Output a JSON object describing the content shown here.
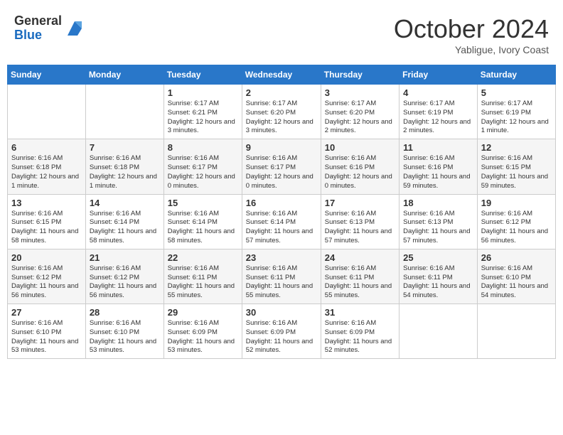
{
  "header": {
    "logo_general": "General",
    "logo_blue": "Blue",
    "month": "October 2024",
    "location": "Yabligue, Ivory Coast"
  },
  "weekdays": [
    "Sunday",
    "Monday",
    "Tuesday",
    "Wednesday",
    "Thursday",
    "Friday",
    "Saturday"
  ],
  "weeks": [
    [
      {
        "day": "",
        "info": ""
      },
      {
        "day": "",
        "info": ""
      },
      {
        "day": "1",
        "info": "Sunrise: 6:17 AM\nSunset: 6:21 PM\nDaylight: 12 hours and 3 minutes."
      },
      {
        "day": "2",
        "info": "Sunrise: 6:17 AM\nSunset: 6:20 PM\nDaylight: 12 hours and 3 minutes."
      },
      {
        "day": "3",
        "info": "Sunrise: 6:17 AM\nSunset: 6:20 PM\nDaylight: 12 hours and 2 minutes."
      },
      {
        "day": "4",
        "info": "Sunrise: 6:17 AM\nSunset: 6:19 PM\nDaylight: 12 hours and 2 minutes."
      },
      {
        "day": "5",
        "info": "Sunrise: 6:17 AM\nSunset: 6:19 PM\nDaylight: 12 hours and 1 minute."
      }
    ],
    [
      {
        "day": "6",
        "info": "Sunrise: 6:16 AM\nSunset: 6:18 PM\nDaylight: 12 hours and 1 minute."
      },
      {
        "day": "7",
        "info": "Sunrise: 6:16 AM\nSunset: 6:18 PM\nDaylight: 12 hours and 1 minute."
      },
      {
        "day": "8",
        "info": "Sunrise: 6:16 AM\nSunset: 6:17 PM\nDaylight: 12 hours and 0 minutes."
      },
      {
        "day": "9",
        "info": "Sunrise: 6:16 AM\nSunset: 6:17 PM\nDaylight: 12 hours and 0 minutes."
      },
      {
        "day": "10",
        "info": "Sunrise: 6:16 AM\nSunset: 6:16 PM\nDaylight: 12 hours and 0 minutes."
      },
      {
        "day": "11",
        "info": "Sunrise: 6:16 AM\nSunset: 6:16 PM\nDaylight: 11 hours and 59 minutes."
      },
      {
        "day": "12",
        "info": "Sunrise: 6:16 AM\nSunset: 6:15 PM\nDaylight: 11 hours and 59 minutes."
      }
    ],
    [
      {
        "day": "13",
        "info": "Sunrise: 6:16 AM\nSunset: 6:15 PM\nDaylight: 11 hours and 58 minutes."
      },
      {
        "day": "14",
        "info": "Sunrise: 6:16 AM\nSunset: 6:14 PM\nDaylight: 11 hours and 58 minutes."
      },
      {
        "day": "15",
        "info": "Sunrise: 6:16 AM\nSunset: 6:14 PM\nDaylight: 11 hours and 58 minutes."
      },
      {
        "day": "16",
        "info": "Sunrise: 6:16 AM\nSunset: 6:14 PM\nDaylight: 11 hours and 57 minutes."
      },
      {
        "day": "17",
        "info": "Sunrise: 6:16 AM\nSunset: 6:13 PM\nDaylight: 11 hours and 57 minutes."
      },
      {
        "day": "18",
        "info": "Sunrise: 6:16 AM\nSunset: 6:13 PM\nDaylight: 11 hours and 57 minutes."
      },
      {
        "day": "19",
        "info": "Sunrise: 6:16 AM\nSunset: 6:12 PM\nDaylight: 11 hours and 56 minutes."
      }
    ],
    [
      {
        "day": "20",
        "info": "Sunrise: 6:16 AM\nSunset: 6:12 PM\nDaylight: 11 hours and 56 minutes."
      },
      {
        "day": "21",
        "info": "Sunrise: 6:16 AM\nSunset: 6:12 PM\nDaylight: 11 hours and 56 minutes."
      },
      {
        "day": "22",
        "info": "Sunrise: 6:16 AM\nSunset: 6:11 PM\nDaylight: 11 hours and 55 minutes."
      },
      {
        "day": "23",
        "info": "Sunrise: 6:16 AM\nSunset: 6:11 PM\nDaylight: 11 hours and 55 minutes."
      },
      {
        "day": "24",
        "info": "Sunrise: 6:16 AM\nSunset: 6:11 PM\nDaylight: 11 hours and 55 minutes."
      },
      {
        "day": "25",
        "info": "Sunrise: 6:16 AM\nSunset: 6:11 PM\nDaylight: 11 hours and 54 minutes."
      },
      {
        "day": "26",
        "info": "Sunrise: 6:16 AM\nSunset: 6:10 PM\nDaylight: 11 hours and 54 minutes."
      }
    ],
    [
      {
        "day": "27",
        "info": "Sunrise: 6:16 AM\nSunset: 6:10 PM\nDaylight: 11 hours and 53 minutes."
      },
      {
        "day": "28",
        "info": "Sunrise: 6:16 AM\nSunset: 6:10 PM\nDaylight: 11 hours and 53 minutes."
      },
      {
        "day": "29",
        "info": "Sunrise: 6:16 AM\nSunset: 6:09 PM\nDaylight: 11 hours and 53 minutes."
      },
      {
        "day": "30",
        "info": "Sunrise: 6:16 AM\nSunset: 6:09 PM\nDaylight: 11 hours and 52 minutes."
      },
      {
        "day": "31",
        "info": "Sunrise: 6:16 AM\nSunset: 6:09 PM\nDaylight: 11 hours and 52 minutes."
      },
      {
        "day": "",
        "info": ""
      },
      {
        "day": "",
        "info": ""
      }
    ]
  ]
}
